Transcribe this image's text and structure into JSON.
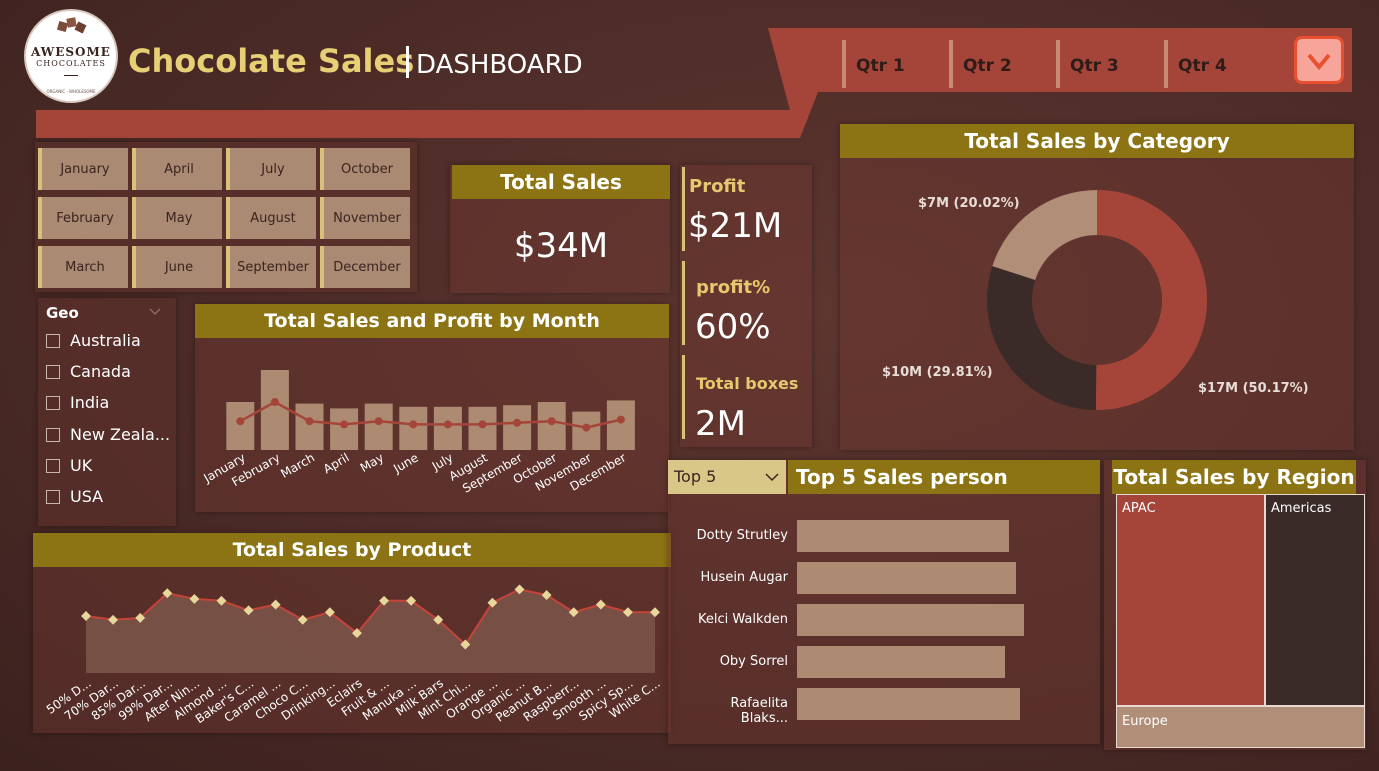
{
  "header": {
    "logo_line1": "AWESOME",
    "logo_line2": "CHOCOLATES",
    "logo_tagline": "ORGANIC · WHOLESOME",
    "title": "Chocolate Sales",
    "subtitle": "DASHBOARD",
    "quarters": [
      "Qtr 1",
      "Qtr 2",
      "Qtr 3",
      "Qtr 4"
    ],
    "accent_color": "#a5453a"
  },
  "months": [
    "January",
    "April",
    "July",
    "October",
    "February",
    "May",
    "August",
    "November",
    "March",
    "June",
    "September",
    "December"
  ],
  "geo": {
    "title": "Geo",
    "items": [
      "Australia",
      "Canada",
      "India",
      "New Zeala...",
      "UK",
      "USA"
    ]
  },
  "kpis": {
    "total_sales_label": "Total Sales",
    "total_sales_value": "$34M",
    "profit_label": "Profit",
    "profit_value": "$21M",
    "profit_pct_label": "profit%",
    "profit_pct_value": "60%",
    "boxes_label": "Total boxes",
    "boxes_value": "2M"
  },
  "monthly_chart": {
    "title": "Total Sales and Profit by Month"
  },
  "category_chart": {
    "title": "Total Sales by Category"
  },
  "product_chart": {
    "title": "Total Sales by Product"
  },
  "salesperson": {
    "dropdown_value": "Top 5",
    "title": "Top 5 Sales person"
  },
  "region_chart": {
    "title": "Total Sales by Region"
  },
  "chart_data": [
    {
      "id": "monthly",
      "type": "bar",
      "categories": [
        "January",
        "February",
        "March",
        "April",
        "May",
        "June",
        "July",
        "August",
        "September",
        "October",
        "November",
        "December"
      ],
      "series": [
        {
          "values": [
            3.0,
            5.0,
            2.9,
            2.6,
            2.9,
            2.7,
            2.7,
            2.7,
            2.8,
            3.0,
            2.4,
            3.1
          ]
        },
        {
          "values": [
            1.8,
            3.0,
            1.8,
            1.6,
            1.8,
            1.6,
            1.6,
            1.6,
            1.7,
            1.8,
            1.4,
            1.9
          ]
        }
      ],
      "colors": [
        "#ad8a72",
        "#a5453a"
      ]
    },
    {
      "id": "category",
      "type": "pie",
      "labels": [
        "$17M (50.17%)",
        "$10M (29.81%)",
        "$7M (20.02%)"
      ],
      "values": [
        50.17,
        29.81,
        20.02
      ],
      "colors": [
        "#a5453a",
        "#3a2a28",
        "#b08e78"
      ]
    },
    {
      "id": "product",
      "type": "area",
      "categories": [
        "50% D...",
        "70% Dar...",
        "85% Dar...",
        "99% Dar...",
        "After Nin...",
        "Almond ...",
        "Baker's C...",
        "Caramel ...",
        "Choco C...",
        "Drinking...",
        "Eclairs",
        "Fruit & ...",
        "Manuka ...",
        "Milk Bars",
        "Mint Chi...",
        "Orange ...",
        "Organic ...",
        "Peanut B...",
        "Raspberr...",
        "Smooth ...",
        "Spicy Sp...",
        "White C..."
      ],
      "values": [
        1.5,
        1.4,
        1.45,
        2.1,
        1.95,
        1.9,
        1.65,
        1.8,
        1.4,
        1.6,
        1.05,
        1.9,
        1.9,
        1.4,
        0.75,
        1.85,
        2.2,
        2.05,
        1.6,
        1.8,
        1.6,
        1.6
      ],
      "colors": [
        "#7a5348",
        "#c4443a",
        "#e8d79a"
      ]
    },
    {
      "id": "salesperson",
      "type": "bar",
      "orientation": "horizontal",
      "categories": [
        "Dotty Strutley",
        "Husein Augar",
        "Kelci Walkden",
        "Oby Sorrel",
        "Rafaelita Blaks..."
      ],
      "values": [
        1.0,
        1.03,
        1.07,
        0.98,
        1.05
      ],
      "colors": [
        "#ad8a72"
      ]
    },
    {
      "id": "region",
      "type": "heatmap",
      "labels": [
        "APAC",
        "Americas",
        "Europe"
      ],
      "colors": [
        "#a5453a",
        "#3a2a28",
        "#b08e78"
      ]
    }
  ]
}
